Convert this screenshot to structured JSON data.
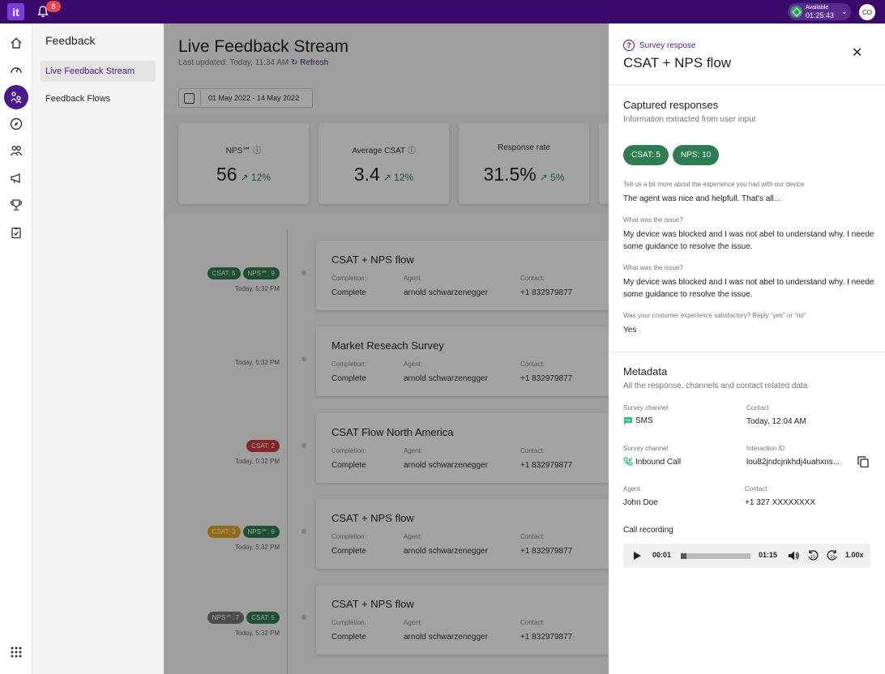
{
  "topbar": {
    "logo": "it",
    "notifications_count": "8",
    "status_label": "Available",
    "status_timer": "01:25:43",
    "avatar_initials": "CO"
  },
  "rail": {
    "icons": [
      "home-icon",
      "speedometer-icon",
      "feedback-icon",
      "compass-icon",
      "users-icon",
      "megaphone-icon",
      "trophy-icon",
      "clipboard-icon",
      "apps-grid-icon"
    ],
    "active": "feedback-icon"
  },
  "sidebar": {
    "title": "Feedback",
    "items": [
      {
        "label": "Live Feedback Stream",
        "active": true
      },
      {
        "label": "Feedback Flows",
        "active": false
      }
    ]
  },
  "main": {
    "title": "Live Feedback Stream",
    "last_updated": "Last updated: Today, 11:34 AM",
    "refresh_label": "Refresh",
    "date_range": "01 May 2022 - 14 May 2022",
    "kpis": [
      {
        "label": "NPS℠",
        "value": "56",
        "delta": "12%"
      },
      {
        "label": "Average CSAT",
        "value": "3.4",
        "delta": "12%"
      },
      {
        "label": "Response rate",
        "value": "31.5%",
        "delta": "5%"
      }
    ],
    "labels": {
      "completion": "Completion:",
      "agent": "Agent:",
      "contact": "Contact:"
    },
    "feed": [
      {
        "title": "CSAT + NPS flow",
        "time": "Today, 5:32 PM",
        "chips": [
          {
            "text": "CSAT: 5",
            "color": "#2e7d52"
          },
          {
            "text": "NPS℠: 9",
            "color": "#2e7d52"
          }
        ],
        "completion": "Complete",
        "agent": "arnold schwarzenegger",
        "contact": "+1 832979877"
      },
      {
        "title": "Market Reseach Survey",
        "time": "Today, 5:32 PM",
        "chips": [],
        "completion": "Complete",
        "agent": "arnold schwarzenegger",
        "contact": "+1 832979877"
      },
      {
        "title": "CSAT Flow North America",
        "time": "Today, 5:32 PM",
        "chips": [
          {
            "text": "CSAT: 2",
            "color": "#d23b3b"
          }
        ],
        "completion": "Complete",
        "agent": "arnold schwarzenegger",
        "contact": "+1 832979877"
      },
      {
        "title": "CSAT + NPS flow",
        "time": "Today, 5:32 PM",
        "chips": [
          {
            "text": "CSAT: 3",
            "color": "#e3a81e"
          },
          {
            "text": "NPS℠: 9",
            "color": "#2e7d52"
          }
        ],
        "completion": "Complete",
        "agent": "arnold schwarzenegger",
        "contact": "+1 832979877"
      },
      {
        "title": "CSAT + NPS flow",
        "time": "Today, 5:32 PM",
        "chips": [
          {
            "text": "NPS℠: 7",
            "color": "#777777"
          },
          {
            "text": "CSAT: 5",
            "color": "#2e7d52"
          }
        ],
        "completion": "Complete",
        "agent": "arnold schwarzenegger",
        "contact": "+1 832979877"
      }
    ]
  },
  "panel": {
    "kicker": "Survey respose",
    "title": "CSAT + NPS flow",
    "captured": {
      "heading": "Captured responses",
      "subheading": "Information extracted from user input",
      "chips": [
        "CSAT: 5",
        "NPS: 10"
      ],
      "qa": [
        {
          "q": "Tell us a bit  more about the experience you had with our device",
          "a": "The  agent was nice and helpfull. That's all..."
        },
        {
          "q": "What was the issue?",
          "a": "My device was blocked and I was not abel to understand why. I neede some guidance to resolve the issue."
        },
        {
          "q": "What was the issue?",
          "a": "My device was blocked and I was not abel to understand why. I neede some guidance to resolve the issue."
        },
        {
          "q": "Was your costumer experience satisfactory? Reply “yes” or “no”",
          "a": "Yes"
        }
      ]
    },
    "metadata": {
      "heading": "Metadata",
      "subheading": "All the response, channels and contact related data",
      "survey_channel_label": "Survey channel",
      "survey_channel_value": "SMS",
      "contact_label": "Contact",
      "contact_value": "Today, 12:04 AM",
      "survey_channel2_label": "Survey channel",
      "survey_channel2_value": "Inbound Call",
      "interaction_label": "Interaction ID",
      "interaction_value": "lou82jndcjnkhdj4uahxns...",
      "agent_label": "Agent",
      "agent_value": "John Doe",
      "contact2_label": "Contact",
      "contact2_value": "+1 327 XXXXXXXX",
      "recording_label": "Call recording",
      "recording": {
        "current": "00:01",
        "duration": "01:15",
        "speed": "1.00x",
        "progress": 0.08
      }
    }
  }
}
